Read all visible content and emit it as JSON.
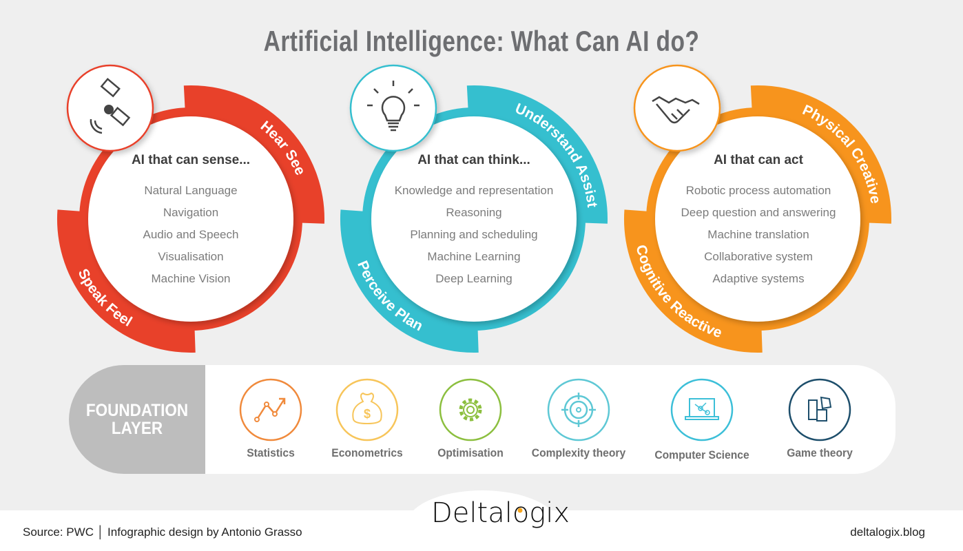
{
  "title": "Artificial Intelligence: What Can AI do?",
  "circles": [
    {
      "heading": "AI that can sense...",
      "color": "#e8412a",
      "icon": "satellite-icon",
      "arc_top": "Hear See",
      "arc_bottom": "Speak Feel",
      "items": [
        "Natural Language",
        "Navigation",
        "Audio and Speech",
        "Visualisation",
        "Machine Vision"
      ]
    },
    {
      "heading": "AI that can think...",
      "color": "#35bfcf",
      "icon": "lightbulb-icon",
      "arc_top": "Understand Assist",
      "arc_bottom": "Perceive Plan",
      "items": [
        "Knowledge and representation",
        "Reasoning",
        "Planning and scheduling",
        "Machine Learning",
        "Deep Learning"
      ]
    },
    {
      "heading": "AI that can act",
      "color": "#f7941d",
      "icon": "handshake-icon",
      "arc_top": "Physical Creative",
      "arc_bottom": "Cognitive Reactive",
      "items": [
        "Robotic process automation",
        "Deep question and answering",
        "Machine translation",
        "Collaborative system",
        "Adaptive systems"
      ]
    }
  ],
  "foundation": {
    "label_line1": "FOUNDATION",
    "label_line2": "LAYER",
    "items": [
      {
        "label": "Statistics",
        "icon": "trend-chart-icon",
        "color": "#f08a3c"
      },
      {
        "label": "Econometrics",
        "icon": "money-bag-icon",
        "color": "#f7c55a"
      },
      {
        "label": "Optimisation",
        "icon": "gear-icon",
        "color": "#8cbf3f"
      },
      {
        "label": "Complexity theory",
        "icon": "target-icon",
        "color": "#5ec8d5"
      },
      {
        "label": "Computer Science",
        "icon": "laptop-network-icon",
        "color": "#3cbfd8"
      },
      {
        "label": "Game theory",
        "icon": "puzzle-icon",
        "color": "#1d4e6b"
      }
    ]
  },
  "footer": {
    "source": "Source: PWC │ Infographic design by Antonio Grasso",
    "logo": "Deltalogix",
    "site": "deltalogix.blog"
  }
}
